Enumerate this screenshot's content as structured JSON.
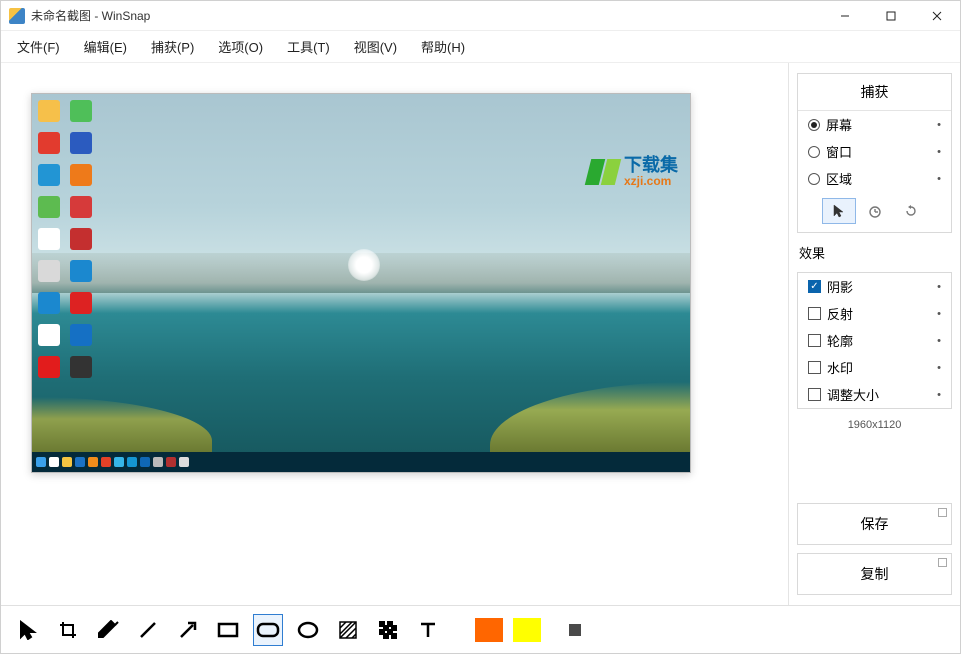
{
  "window": {
    "title": "未命名截图 - WinSnap"
  },
  "menu": {
    "file": "文件(F)",
    "edit": "编辑(E)",
    "capture": "捕获(P)",
    "options": "选项(O)",
    "tools": "工具(T)",
    "view": "视图(V)",
    "help": "帮助(H)"
  },
  "side": {
    "capture_header": "捕获",
    "capture_modes": {
      "screen": "屏幕",
      "window": "窗口",
      "region": "区域"
    },
    "selected_mode": "screen",
    "effects_header": "效果",
    "effects": {
      "shadow": {
        "label": "阴影",
        "checked": true
      },
      "reflection": {
        "label": "反射",
        "checked": false
      },
      "outline": {
        "label": "轮廓",
        "checked": false
      },
      "watermark": {
        "label": "水印",
        "checked": false
      },
      "resize": {
        "label": "调整大小",
        "checked": false
      }
    },
    "dimensions": "1960x1120",
    "save_label": "保存",
    "copy_label": "复制"
  },
  "toolbar": {
    "colors": {
      "primary": "#ff6600",
      "secondary": "#ffff00",
      "stroke": "#4a4a4a"
    },
    "selected_tool": "rounded-rectangle"
  },
  "preview": {
    "watermark_cn": "下载集",
    "watermark_en": "xzji.com"
  }
}
